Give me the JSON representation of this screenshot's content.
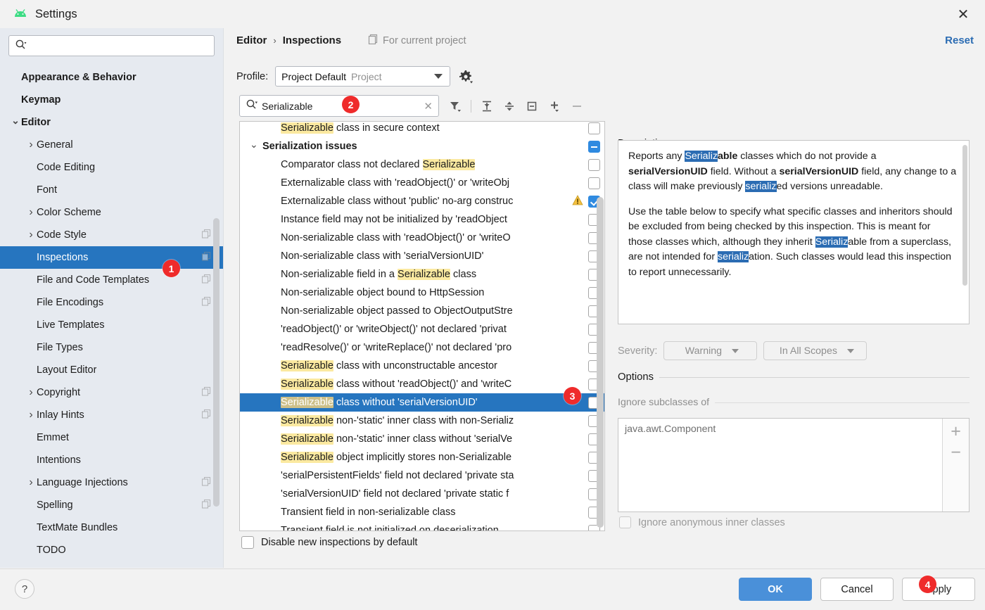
{
  "window": {
    "title": "Settings",
    "close_label": "✕",
    "logo": "android-logo"
  },
  "sidebar": {
    "search": {
      "value": "",
      "placeholder": ""
    },
    "items": [
      {
        "label": "Appearance & Behavior",
        "level": 0,
        "bold": true,
        "twisty": "",
        "copy": false,
        "selected": false
      },
      {
        "label": "Keymap",
        "level": 0,
        "bold": true,
        "twisty": "",
        "copy": false,
        "selected": false
      },
      {
        "label": "Editor",
        "level": 0,
        "bold": true,
        "twisty": "v",
        "copy": false,
        "selected": false
      },
      {
        "label": "General",
        "level": 1,
        "bold": false,
        "twisty": ">",
        "copy": false,
        "selected": false
      },
      {
        "label": "Code Editing",
        "level": 1,
        "bold": false,
        "twisty": "",
        "copy": false,
        "selected": false
      },
      {
        "label": "Font",
        "level": 1,
        "bold": false,
        "twisty": "",
        "copy": false,
        "selected": false
      },
      {
        "label": "Color Scheme",
        "level": 1,
        "bold": false,
        "twisty": ">",
        "copy": false,
        "selected": false
      },
      {
        "label": "Code Style",
        "level": 1,
        "bold": false,
        "twisty": ">",
        "copy": true,
        "selected": false
      },
      {
        "label": "Inspections",
        "level": 1,
        "bold": false,
        "twisty": "",
        "copy": true,
        "selected": true
      },
      {
        "label": "File and Code Templates",
        "level": 1,
        "bold": false,
        "twisty": "",
        "copy": true,
        "selected": false
      },
      {
        "label": "File Encodings",
        "level": 1,
        "bold": false,
        "twisty": "",
        "copy": true,
        "selected": false
      },
      {
        "label": "Live Templates",
        "level": 1,
        "bold": false,
        "twisty": "",
        "copy": false,
        "selected": false
      },
      {
        "label": "File Types",
        "level": 1,
        "bold": false,
        "twisty": "",
        "copy": false,
        "selected": false
      },
      {
        "label": "Layout Editor",
        "level": 1,
        "bold": false,
        "twisty": "",
        "copy": false,
        "selected": false
      },
      {
        "label": "Copyright",
        "level": 1,
        "bold": false,
        "twisty": ">",
        "copy": true,
        "selected": false
      },
      {
        "label": "Inlay Hints",
        "level": 1,
        "bold": false,
        "twisty": ">",
        "copy": true,
        "selected": false
      },
      {
        "label": "Emmet",
        "level": 1,
        "bold": false,
        "twisty": "",
        "copy": false,
        "selected": false
      },
      {
        "label": "Intentions",
        "level": 1,
        "bold": false,
        "twisty": "",
        "copy": false,
        "selected": false
      },
      {
        "label": "Language Injections",
        "level": 1,
        "bold": false,
        "twisty": ">",
        "copy": true,
        "selected": false
      },
      {
        "label": "Spelling",
        "level": 1,
        "bold": false,
        "twisty": "",
        "copy": true,
        "selected": false
      },
      {
        "label": "TextMate Bundles",
        "level": 1,
        "bold": false,
        "twisty": "",
        "copy": false,
        "selected": false
      },
      {
        "label": "TODO",
        "level": 1,
        "bold": false,
        "twisty": "",
        "copy": false,
        "selected": false
      }
    ]
  },
  "header": {
    "breadcrumb_parent": "Editor",
    "breadcrumb_separator": "›",
    "breadcrumb_current": "Inspections",
    "for_current_project": "For current project",
    "reset_label": "Reset"
  },
  "profile": {
    "label": "Profile:",
    "value": "Project Default",
    "scope": "Project",
    "gear_icon": "gear-icon"
  },
  "filter": {
    "value": "Serializable",
    "placeholder": "",
    "clear": "✕",
    "tools": [
      {
        "name": "filter-icon",
        "label": "Filter"
      },
      {
        "name": "expand-all-icon",
        "label": "Expand All"
      },
      {
        "name": "collapse-all-icon",
        "label": "Collapse All"
      },
      {
        "name": "collapse-node-icon",
        "label": "Collapse Node"
      },
      {
        "name": "add-icon",
        "label": "Add"
      },
      {
        "name": "remove-icon",
        "label": "Remove"
      }
    ]
  },
  "inspection_list": [
    {
      "type": "item",
      "pre": "",
      "hl": "Serializable",
      "post": " class in secure context",
      "state": "unchecked",
      "warn": false,
      "selected": false,
      "partial": true
    },
    {
      "type": "group",
      "pre": "Serialization issues",
      "hl": "",
      "post": "",
      "state": "indeterminate",
      "warn": false,
      "selected": false
    },
    {
      "type": "item",
      "pre": "Comparator class not declared ",
      "hl": "Serializable",
      "post": "",
      "state": "unchecked",
      "warn": false,
      "selected": false
    },
    {
      "type": "item",
      "pre": "Externalizable class with 'readObject()' or 'writeObj",
      "hl": "",
      "post": "",
      "state": "unchecked",
      "warn": false,
      "selected": false
    },
    {
      "type": "item",
      "pre": "Externalizable class without 'public' no-arg construc",
      "hl": "",
      "post": "",
      "state": "checked",
      "warn": true,
      "selected": false
    },
    {
      "type": "item",
      "pre": "Instance field may not be initialized by 'readObject",
      "hl": "",
      "post": "",
      "state": "unchecked",
      "warn": false,
      "selected": false
    },
    {
      "type": "item",
      "pre": "Non-serializable class with 'readObject()' or 'writeO",
      "hl": "",
      "post": "",
      "state": "unchecked",
      "warn": false,
      "selected": false
    },
    {
      "type": "item",
      "pre": "Non-serializable class with 'serialVersionUID'",
      "hl": "",
      "post": "",
      "state": "unchecked",
      "warn": false,
      "selected": false
    },
    {
      "type": "item",
      "pre": "Non-serializable field in a ",
      "hl": "Serializable",
      "post": " class",
      "state": "unchecked",
      "warn": false,
      "selected": false
    },
    {
      "type": "item",
      "pre": "Non-serializable object bound to HttpSession",
      "hl": "",
      "post": "",
      "state": "unchecked",
      "warn": false,
      "selected": false
    },
    {
      "type": "item",
      "pre": "Non-serializable object passed to ObjectOutputStre",
      "hl": "",
      "post": "",
      "state": "unchecked",
      "warn": false,
      "selected": false
    },
    {
      "type": "item",
      "pre": "'readObject()' or 'writeObject()' not declared 'privat",
      "hl": "",
      "post": "",
      "state": "unchecked",
      "warn": false,
      "selected": false
    },
    {
      "type": "item",
      "pre": "'readResolve()' or 'writeReplace()' not declared 'pro",
      "hl": "",
      "post": "",
      "state": "unchecked",
      "warn": false,
      "selected": false
    },
    {
      "type": "item",
      "pre": "",
      "hl": "Serializable",
      "post": " class with unconstructable ancestor",
      "state": "unchecked",
      "warn": false,
      "selected": false
    },
    {
      "type": "item",
      "pre": "",
      "hl": "Serializable",
      "post": " class without 'readObject()' and 'writeC",
      "state": "unchecked",
      "warn": false,
      "selected": false
    },
    {
      "type": "item",
      "pre": "",
      "hl": "Serializable",
      "post": " class without 'serialVersionUID'",
      "state": "unchecked",
      "warn": false,
      "selected": true
    },
    {
      "type": "item",
      "pre": "",
      "hl": "Serializable",
      "post": " non-'static' inner class with non-Serializ",
      "state": "unchecked",
      "warn": false,
      "selected": false
    },
    {
      "type": "item",
      "pre": "",
      "hl": "Serializable",
      "post": " non-'static' inner class without 'serialVe",
      "state": "unchecked",
      "warn": false,
      "selected": false
    },
    {
      "type": "item",
      "pre": "",
      "hl": "Serializable",
      "post": " object implicitly stores non-Serializable",
      "state": "unchecked",
      "warn": false,
      "selected": false
    },
    {
      "type": "item",
      "pre": "'serialPersistentFields' field not declared 'private sta",
      "hl": "",
      "post": "",
      "state": "unchecked",
      "warn": false,
      "selected": false
    },
    {
      "type": "item",
      "pre": "'serialVersionUID' field not declared 'private static f",
      "hl": "",
      "post": "",
      "state": "unchecked",
      "warn": false,
      "selected": false
    },
    {
      "type": "item",
      "pre": "Transient field in non-serializable class",
      "hl": "",
      "post": "",
      "state": "unchecked",
      "warn": false,
      "selected": false
    },
    {
      "type": "item",
      "pre": "Transient field is not initialized on deserialization",
      "hl": "",
      "post": "",
      "state": "unchecked",
      "warn": false,
      "selected": false
    }
  ],
  "disable_new": {
    "label": "Disable new inspections by default",
    "checked": false
  },
  "description": {
    "label": "Description:",
    "p1": {
      "a": "Reports any ",
      "sel1": "Serializ",
      "b1": "able",
      "c": " classes which do not provide a ",
      "bold1": "serialVersionUID",
      "d": " field. Without a ",
      "bold2": "serialVersionUID",
      "e": " field, any change to a class will make previously ",
      "sel2": "serializ",
      "f": "ed versions unreadable."
    },
    "p2": {
      "a": "Use the table below to specify what specific classes and inheritors should be excluded from being checked by this inspection. This is meant for those classes which, although they inherit ",
      "sel1": "Serializ",
      "b": "able from a superclass, are not intended for ",
      "sel2": "serializ",
      "c": "ation. Such classes would lead this inspection to report unnecessarily."
    }
  },
  "severity": {
    "label": "Severity:",
    "value": "Warning",
    "scope": "In All Scopes"
  },
  "options": {
    "title": "Options",
    "ignore_subclasses_label": "Ignore subclasses of",
    "classes": [
      "java.awt.Component"
    ],
    "add_label": "+",
    "remove_label": "−",
    "ignore_anonymous": {
      "label": "Ignore anonymous inner classes",
      "checked": false
    }
  },
  "footer": {
    "help_label": "?",
    "ok_label": "OK",
    "cancel_label": "Cancel",
    "apply_label": "Apply"
  },
  "badges": [
    {
      "id": 1,
      "label": "1"
    },
    {
      "id": 2,
      "label": "2"
    },
    {
      "id": 3,
      "label": "3"
    },
    {
      "id": 4,
      "label": "4"
    }
  ],
  "colors": {
    "accent": "#2675bf",
    "badge": "#ef2b2b",
    "highlight": "#fbe9a0",
    "selection": "#2b6cb3",
    "primary_button": "#4a90d9",
    "sidebar_bg": "#e6eaf0"
  }
}
